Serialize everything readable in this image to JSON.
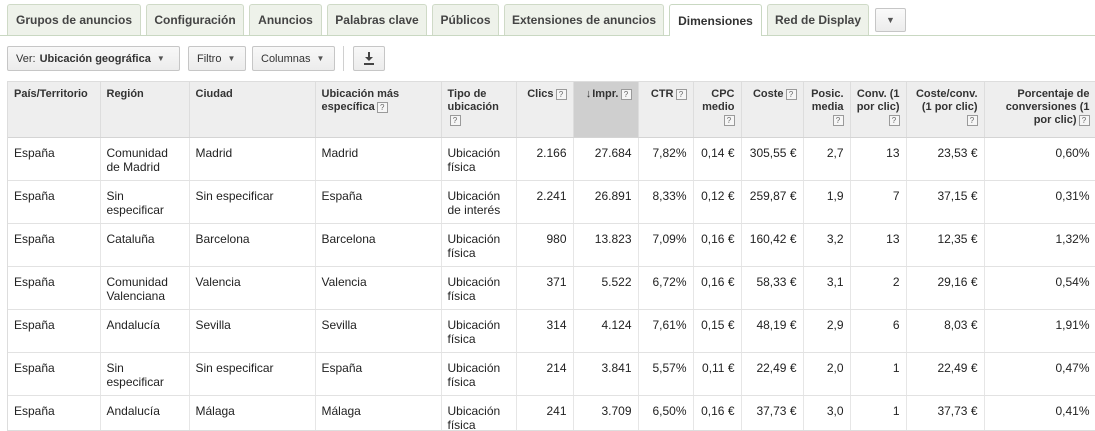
{
  "tabs": [
    {
      "label": "Grupos de anuncios",
      "active": false
    },
    {
      "label": "Configuración",
      "active": false
    },
    {
      "label": "Anuncios",
      "active": false
    },
    {
      "label": "Palabras clave",
      "active": false
    },
    {
      "label": "Públicos",
      "active": false
    },
    {
      "label": "Extensiones de anuncios",
      "active": false
    },
    {
      "label": "Dimensiones",
      "active": true
    },
    {
      "label": "Red de Display",
      "active": false
    }
  ],
  "toolbar": {
    "view_prefix": "Ver:",
    "view_value": "Ubicación geográfica",
    "filter_label": "Filtro",
    "columns_label": "Columnas",
    "download_icon": "download-icon",
    "help_glyph": "?"
  },
  "table": {
    "sorted_column": "impr",
    "sort_direction": "descending",
    "columns": [
      {
        "key": "country",
        "label": "País/Territorio",
        "help": false,
        "numeric": false
      },
      {
        "key": "region",
        "label": "Región",
        "help": false,
        "numeric": false
      },
      {
        "key": "city",
        "label": "Ciudad",
        "help": false,
        "numeric": false
      },
      {
        "key": "most_specific",
        "label": "Ubicación más específica",
        "help": true,
        "numeric": false
      },
      {
        "key": "location_type",
        "label": "Tipo de ubicación",
        "help": true,
        "numeric": false
      },
      {
        "key": "clicks",
        "label": "Clics",
        "help": true,
        "numeric": true
      },
      {
        "key": "impr",
        "label": "Impr.",
        "help": true,
        "numeric": true
      },
      {
        "key": "ctr",
        "label": "CTR",
        "help": true,
        "numeric": true
      },
      {
        "key": "cpc",
        "label": "CPC medio",
        "help": true,
        "numeric": true
      },
      {
        "key": "cost",
        "label": "Coste",
        "help": true,
        "numeric": true
      },
      {
        "key": "pos",
        "label": "Posic. media",
        "help": true,
        "numeric": true
      },
      {
        "key": "conv",
        "label": "Conv. (1 por clic)",
        "help": true,
        "numeric": true
      },
      {
        "key": "cost_conv",
        "label": "Coste/conv. (1 por clic)",
        "help": true,
        "numeric": true
      },
      {
        "key": "conv_rate",
        "label": "Porcentaje de conversiones (1 por clic)",
        "help": true,
        "numeric": true
      }
    ],
    "rows": [
      [
        "España",
        "Comunidad de Madrid",
        "Madrid",
        "Madrid",
        "Ubicación física",
        "2.166",
        "27.684",
        "7,82%",
        "0,14 €",
        "305,55 €",
        "2,7",
        "13",
        "23,53 €",
        "0,60%"
      ],
      [
        "España",
        "Sin especificar",
        "Sin especificar",
        "España",
        "Ubicación de interés",
        "2.241",
        "26.891",
        "8,33%",
        "0,12 €",
        "259,87 €",
        "1,9",
        "7",
        "37,15 €",
        "0,31%"
      ],
      [
        "España",
        "Cataluña",
        "Barcelona",
        "Barcelona",
        "Ubicación física",
        "980",
        "13.823",
        "7,09%",
        "0,16 €",
        "160,42 €",
        "3,2",
        "13",
        "12,35 €",
        "1,32%"
      ],
      [
        "España",
        "Comunidad Valenciana",
        "Valencia",
        "Valencia",
        "Ubicación física",
        "371",
        "5.522",
        "6,72%",
        "0,16 €",
        "58,33 €",
        "3,1",
        "2",
        "29,16 €",
        "0,54%"
      ],
      [
        "España",
        "Andalucía",
        "Sevilla",
        "Sevilla",
        "Ubicación física",
        "314",
        "4.124",
        "7,61%",
        "0,15 €",
        "48,19 €",
        "2,9",
        "6",
        "8,03 €",
        "1,91%"
      ],
      [
        "España",
        "Sin especificar",
        "Sin especificar",
        "España",
        "Ubicación física",
        "214",
        "3.841",
        "5,57%",
        "0,11 €",
        "22,49 €",
        "2,0",
        "1",
        "22,49 €",
        "0,47%"
      ],
      [
        "España",
        "Andalucía",
        "Málaga",
        "Málaga",
        "Ubicación física",
        "241",
        "3.709",
        "6,50%",
        "0,16 €",
        "37,73 €",
        "3,0",
        "1",
        "37,73 €",
        "0,41%"
      ]
    ]
  },
  "colors": {
    "tab_bg": "#eef2ea",
    "tab_border": "#cfdac7",
    "header_bg": "#eeeeee",
    "sorted_header_bg": "#cfcfcf"
  }
}
